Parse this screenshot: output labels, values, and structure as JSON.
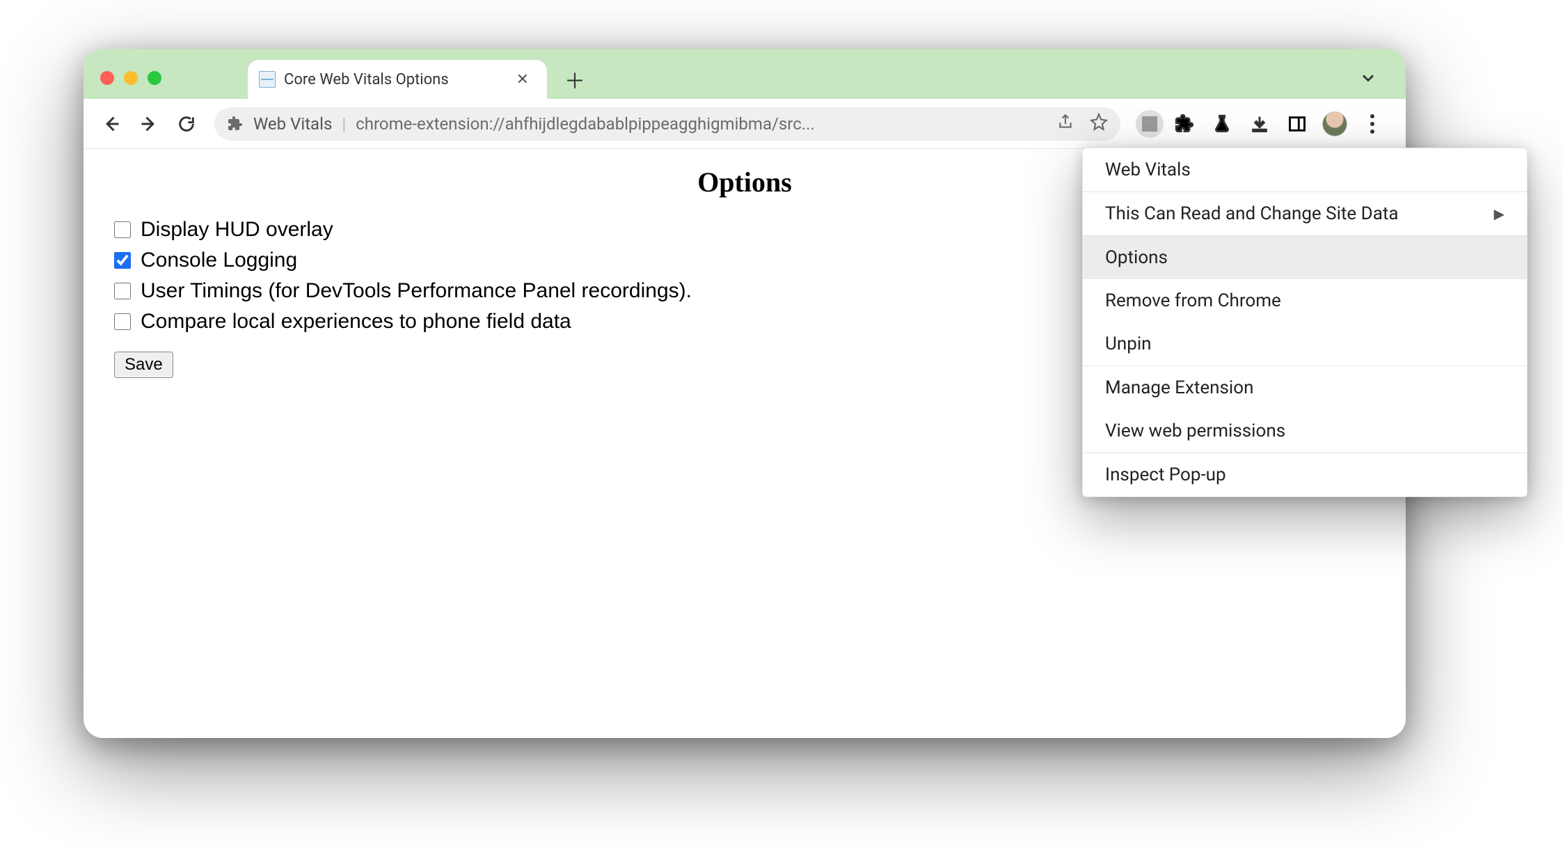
{
  "tab": {
    "title": "Core Web Vitals Options"
  },
  "omnibox": {
    "site_label": "Web Vitals",
    "url": "chrome-extension://ahfhijdlegdabablpippeagghigmibma/src..."
  },
  "page": {
    "heading": "Options",
    "options": [
      {
        "label": "Display HUD overlay",
        "checked": false
      },
      {
        "label": "Console Logging",
        "checked": true
      },
      {
        "label": "User Timings (for DevTools Performance Panel recordings).",
        "checked": false
      },
      {
        "label": "Compare local experiences to phone field data",
        "checked": false
      }
    ],
    "save_label": "Save"
  },
  "context_menu": {
    "title": "Web Vitals",
    "items_group1": [
      {
        "label": "This Can Read and Change Site Data",
        "submenu": true
      }
    ],
    "items_group2": [
      {
        "label": "Options",
        "hover": true
      },
      {
        "label": "Remove from Chrome"
      },
      {
        "label": "Unpin"
      }
    ],
    "items_group3": [
      {
        "label": "Manage Extension"
      },
      {
        "label": "View web permissions"
      }
    ],
    "items_group4": [
      {
        "label": "Inspect Pop-up"
      }
    ]
  }
}
